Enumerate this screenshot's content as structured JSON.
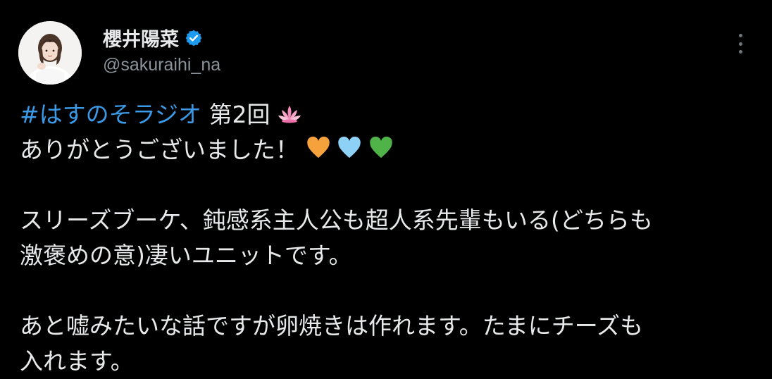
{
  "author": {
    "name": "櫻井陽菜",
    "handle": "@sakuraihi_na",
    "verified": true
  },
  "tweet": {
    "line1_hashtag": "#はすのそラジオ",
    "line1_text": " 第2回",
    "line1_emoji": "lotus-emoji",
    "line2_text": "ありがとうございました！",
    "line2_emojis": [
      "orange-heart",
      "light-blue-heart",
      "green-heart"
    ],
    "paragraph2_line1": "スリーズブーケ、鈍感系主人公も超人系先輩もいる(どちらも",
    "paragraph2_line2": "激褒めの意)凄いユニットです。",
    "paragraph3_line1": "あと嘘みたいな話ですが卵焼きは作れます。たまにチーズも",
    "paragraph3_line2": "入れます。"
  },
  "colors": {
    "background": "#000000",
    "text": "#e7e9ea",
    "secondary": "#8b949b",
    "hashtag": "#3b9ae8",
    "verified": "#1d9bf0"
  }
}
